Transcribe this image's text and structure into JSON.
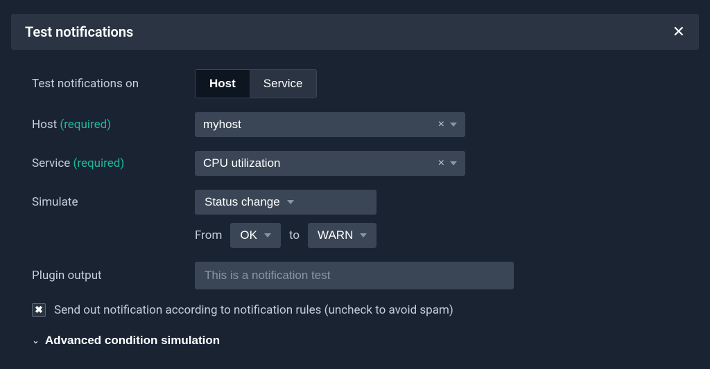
{
  "dialog": {
    "title": "Test notifications"
  },
  "form": {
    "test_on": {
      "label": "Test notifications on",
      "tabs": {
        "host": "Host",
        "service": "Service"
      },
      "active": "host"
    },
    "host": {
      "label": "Host ",
      "required": "(required)",
      "value": "myhost"
    },
    "service": {
      "label": "Service ",
      "required": "(required)",
      "value": "CPU utilization"
    },
    "simulate": {
      "label": "Simulate",
      "mode": "Status change",
      "from_label": "From",
      "from_value": "OK",
      "to_label": "to",
      "to_value": "WARN"
    },
    "plugin_output": {
      "label": "Plugin output",
      "placeholder": "This is a notification test",
      "value": ""
    },
    "send_checkbox": {
      "checked": true,
      "label": "Send out notification according to notification rules (uncheck to avoid spam)"
    },
    "advanced": {
      "label": "Advanced condition simulation"
    }
  }
}
